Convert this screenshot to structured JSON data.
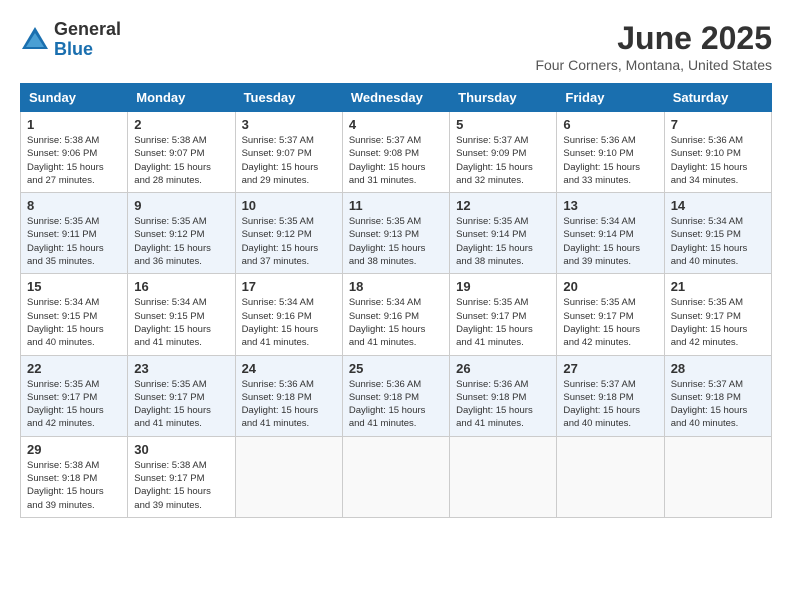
{
  "header": {
    "logo_general": "General",
    "logo_blue": "Blue",
    "month_year": "June 2025",
    "location": "Four Corners, Montana, United States"
  },
  "calendar": {
    "days_of_week": [
      "Sunday",
      "Monday",
      "Tuesday",
      "Wednesday",
      "Thursday",
      "Friday",
      "Saturday"
    ],
    "weeks": [
      [
        {
          "day": "1",
          "sunrise": "5:38 AM",
          "sunset": "9:06 PM",
          "daylight": "15 hours and 27 minutes."
        },
        {
          "day": "2",
          "sunrise": "5:38 AM",
          "sunset": "9:07 PM",
          "daylight": "15 hours and 28 minutes."
        },
        {
          "day": "3",
          "sunrise": "5:37 AM",
          "sunset": "9:07 PM",
          "daylight": "15 hours and 29 minutes."
        },
        {
          "day": "4",
          "sunrise": "5:37 AM",
          "sunset": "9:08 PM",
          "daylight": "15 hours and 31 minutes."
        },
        {
          "day": "5",
          "sunrise": "5:37 AM",
          "sunset": "9:09 PM",
          "daylight": "15 hours and 32 minutes."
        },
        {
          "day": "6",
          "sunrise": "5:36 AM",
          "sunset": "9:10 PM",
          "daylight": "15 hours and 33 minutes."
        },
        {
          "day": "7",
          "sunrise": "5:36 AM",
          "sunset": "9:10 PM",
          "daylight": "15 hours and 34 minutes."
        }
      ],
      [
        {
          "day": "8",
          "sunrise": "5:35 AM",
          "sunset": "9:11 PM",
          "daylight": "15 hours and 35 minutes."
        },
        {
          "day": "9",
          "sunrise": "5:35 AM",
          "sunset": "9:12 PM",
          "daylight": "15 hours and 36 minutes."
        },
        {
          "day": "10",
          "sunrise": "5:35 AM",
          "sunset": "9:12 PM",
          "daylight": "15 hours and 37 minutes."
        },
        {
          "day": "11",
          "sunrise": "5:35 AM",
          "sunset": "9:13 PM",
          "daylight": "15 hours and 38 minutes."
        },
        {
          "day": "12",
          "sunrise": "5:35 AM",
          "sunset": "9:14 PM",
          "daylight": "15 hours and 38 minutes."
        },
        {
          "day": "13",
          "sunrise": "5:34 AM",
          "sunset": "9:14 PM",
          "daylight": "15 hours and 39 minutes."
        },
        {
          "day": "14",
          "sunrise": "5:34 AM",
          "sunset": "9:15 PM",
          "daylight": "15 hours and 40 minutes."
        }
      ],
      [
        {
          "day": "15",
          "sunrise": "5:34 AM",
          "sunset": "9:15 PM",
          "daylight": "15 hours and 40 minutes."
        },
        {
          "day": "16",
          "sunrise": "5:34 AM",
          "sunset": "9:15 PM",
          "daylight": "15 hours and 41 minutes."
        },
        {
          "day": "17",
          "sunrise": "5:34 AM",
          "sunset": "9:16 PM",
          "daylight": "15 hours and 41 minutes."
        },
        {
          "day": "18",
          "sunrise": "5:34 AM",
          "sunset": "9:16 PM",
          "daylight": "15 hours and 41 minutes."
        },
        {
          "day": "19",
          "sunrise": "5:35 AM",
          "sunset": "9:17 PM",
          "daylight": "15 hours and 41 minutes."
        },
        {
          "day": "20",
          "sunrise": "5:35 AM",
          "sunset": "9:17 PM",
          "daylight": "15 hours and 42 minutes."
        },
        {
          "day": "21",
          "sunrise": "5:35 AM",
          "sunset": "9:17 PM",
          "daylight": "15 hours and 42 minutes."
        }
      ],
      [
        {
          "day": "22",
          "sunrise": "5:35 AM",
          "sunset": "9:17 PM",
          "daylight": "15 hours and 42 minutes."
        },
        {
          "day": "23",
          "sunrise": "5:35 AM",
          "sunset": "9:17 PM",
          "daylight": "15 hours and 41 minutes."
        },
        {
          "day": "24",
          "sunrise": "5:36 AM",
          "sunset": "9:18 PM",
          "daylight": "15 hours and 41 minutes."
        },
        {
          "day": "25",
          "sunrise": "5:36 AM",
          "sunset": "9:18 PM",
          "daylight": "15 hours and 41 minutes."
        },
        {
          "day": "26",
          "sunrise": "5:36 AM",
          "sunset": "9:18 PM",
          "daylight": "15 hours and 41 minutes."
        },
        {
          "day": "27",
          "sunrise": "5:37 AM",
          "sunset": "9:18 PM",
          "daylight": "15 hours and 40 minutes."
        },
        {
          "day": "28",
          "sunrise": "5:37 AM",
          "sunset": "9:18 PM",
          "daylight": "15 hours and 40 minutes."
        }
      ],
      [
        {
          "day": "29",
          "sunrise": "5:38 AM",
          "sunset": "9:18 PM",
          "daylight": "15 hours and 39 minutes."
        },
        {
          "day": "30",
          "sunrise": "5:38 AM",
          "sunset": "9:17 PM",
          "daylight": "15 hours and 39 minutes."
        },
        null,
        null,
        null,
        null,
        null
      ]
    ]
  }
}
